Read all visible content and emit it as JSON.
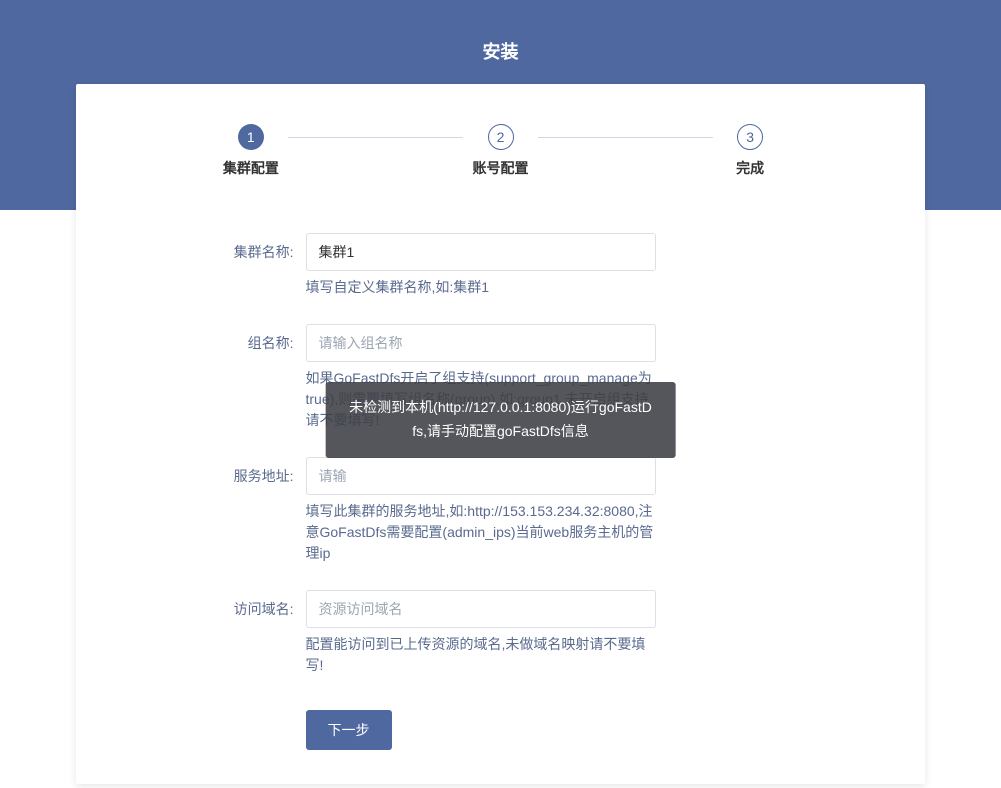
{
  "header": {
    "title": "安装"
  },
  "steps": [
    {
      "num": "1",
      "label": "集群配置",
      "active": true
    },
    {
      "num": "2",
      "label": "账号配置",
      "active": false
    },
    {
      "num": "3",
      "label": "完成",
      "active": false
    }
  ],
  "form": {
    "clusterName": {
      "label": "集群名称:",
      "value": "集群1",
      "hint": "填写自定义集群名称,如:集群1"
    },
    "groupName": {
      "label": "组名称:",
      "placeholder": "请输入组名称",
      "hint": "如果GoFastDfs开启了组支持(support_group_manage为true),则需要填写组名称(group),如:group1,未开启组支持请不要填写!"
    },
    "serviceAddr": {
      "label": "服务地址:",
      "placeholder": "请输",
      "hint": "填写此集群的服务地址,如:http://153.153.234.32:8080,注意GoFastDfs需要配置(admin_ips)当前web服务主机的管理ip"
    },
    "accessDomain": {
      "label": "访问域名:",
      "placeholder": "资源访问域名",
      "hint": "配置能访问到已上传资源的域名,未做域名映射请不要填写!"
    },
    "submitLabel": "下一步"
  },
  "toast": {
    "line1": "未检测到本机(http://127.0.0.1:8080)运行goFastD",
    "line2": "fs,请手动配置goFastDfs信息"
  }
}
